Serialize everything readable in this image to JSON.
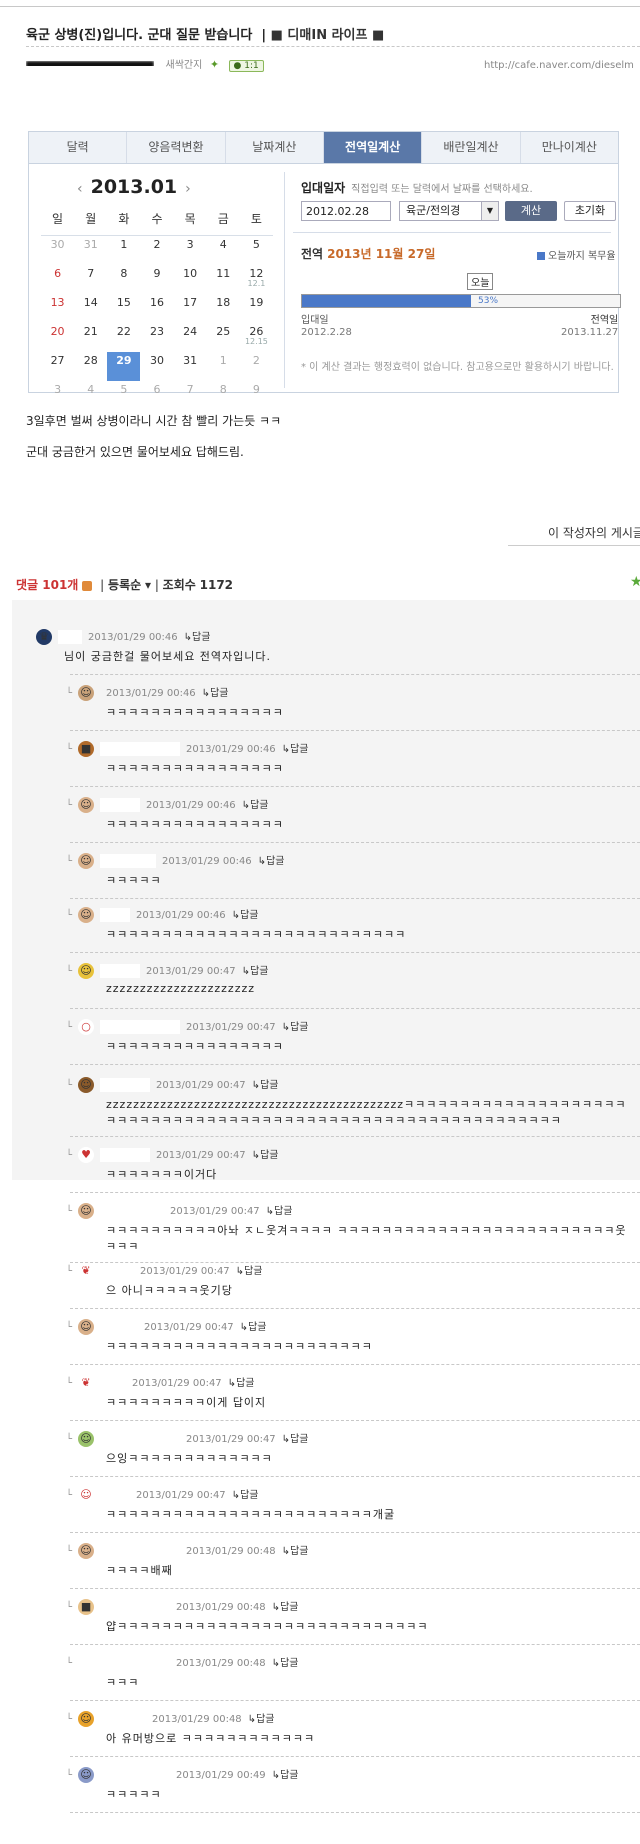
{
  "post": {
    "title": "육군 상병(진)입니다. 군대 질문 받습니다",
    "category": "■ 디매IN 라이프 ■",
    "author_grade": "새싹간지",
    "comment_badge": "1:1",
    "url": "http://cafe.naver.com/dieselm",
    "body_line1": "3일후면 벌써 상병이라니 시간 참 빨리 가는듯 ㅋㅋ",
    "body_line2": "군대 궁금한거 있으면 물어보세요 답해드림.",
    "more_link": "이 작성자의 게시글"
  },
  "calculator": {
    "tabs": [
      "달력",
      "양음력변환",
      "날짜계산",
      "전역일계산",
      "배란일계산",
      "만나이계산"
    ],
    "active_tab": "전역일계산",
    "month_title": "2013.01",
    "prev": "‹",
    "next": "›",
    "weekdays": [
      "일",
      "월",
      "화",
      "수",
      "목",
      "금",
      "토"
    ],
    "weeks": [
      [
        "30",
        "31",
        "1",
        "2",
        "3",
        "4",
        "5"
      ],
      [
        "6",
        "7",
        "8",
        "9",
        "10",
        "11",
        "12"
      ],
      [
        "13",
        "14",
        "15",
        "16",
        "17",
        "18",
        "19"
      ],
      [
        "20",
        "21",
        "22",
        "23",
        "24",
        "25",
        "26"
      ],
      [
        "27",
        "28",
        "29",
        "30",
        "31",
        "1",
        "2"
      ],
      [
        "3",
        "4",
        "5",
        "6",
        "7",
        "8",
        "9"
      ]
    ],
    "subnote_12": "12.1",
    "subnote_26": "12.15",
    "selected_day": "29",
    "enlist_label": "입대일자",
    "enlist_hint": "직접입력 또는 달력에서 날짜를 선택하세요.",
    "enlist_date": "2012.02.28",
    "branch": "육군/전의경",
    "calc_button": "계산",
    "reset_button": "초기화",
    "discharge_label": "전역",
    "discharge_date": "2013년 11월 27일",
    "legend": "오늘까지 복무율",
    "today_label": "오늘",
    "progress_percent": 53,
    "progress_text": "53%",
    "start_label": "입대일",
    "start_date": "2012.2.28",
    "end_label": "전역일",
    "end_date": "2013.11.27",
    "note": "* 이 계산 결과는 행정효력이 없습니다. 참고용으로만 활용하시기 바랍니다."
  },
  "comments_bar": {
    "count_label": "댓글 101개",
    "sort": "등록순",
    "views_label": "조회수",
    "views": "1172"
  },
  "comments": [
    {
      "time": "2013/01/29 00:46",
      "reply": "답글",
      "text": "님이 궁금한걸 물어보세요 전역자입니다.",
      "color": "#223a66",
      "icon": "♛"
    },
    {
      "time": "2013/01/29 00:46",
      "reply": "답글",
      "text": "ㅋㅋㅋㅋㅋㅋㅋㅋㅋㅋㅋㅋㅋㅋㅋㅋ",
      "color": "#c9a27a",
      "icon": "☺"
    },
    {
      "time": "2013/01/29 00:46",
      "reply": "답글",
      "text": "ㅋㅋㅋㅋㅋㅋㅋㅋㅋㅋㅋㅋㅋㅋㅋㅋ",
      "color": "#b06a2a",
      "icon": "■"
    },
    {
      "time": "2013/01/29 00:46",
      "reply": "답글",
      "text": "ㅋㅋㅋㅋㅋㅋㅋㅋㅋㅋㅋㅋㅋㅋㅋㅋ",
      "color": "#d9b08a",
      "icon": "☺"
    },
    {
      "time": "2013/01/29 00:46",
      "reply": "답글",
      "text": "ㅋㅋㅋㅋㅋ",
      "color": "#d9b08a",
      "icon": "☺"
    },
    {
      "time": "2013/01/29 00:46",
      "reply": "답글",
      "text": "ㅋㅋㅋㅋㅋㅋㅋㅋㅋㅋㅋㅋㅋㅋㅋㅋㅋㅋㅋㅋㅋㅋㅋㅋㅋㅋㅋ",
      "color": "#d9b08a",
      "icon": "☺"
    },
    {
      "time": "2013/01/29 00:47",
      "reply": "답글",
      "text": "zzzzzzzzzzzzzzzzzzzzzz",
      "color": "#e8c23a",
      "icon": "☺"
    },
    {
      "time": "2013/01/29 00:47",
      "reply": "답글",
      "text": "ㅋㅋㅋㅋㅋㅋㅋㅋㅋㅋㅋㅋㅋㅋㅋㅋ",
      "color": "#ffffff",
      "icon": "○"
    },
    {
      "time": "2013/01/29 00:47",
      "reply": "답글",
      "text": "zzzzzzzzzzzzzzzzzzzzzzzzzzzzzzzzzzzzzzzzzzzzㅋㅋㅋㅋㅋㅋㅋㅋㅋㅋㅋㅋㅋㅋㅋㅋㅋㅋㅋㅋ",
      "text2": "ㅋㅋㅋㅋㅋㅋㅋㅋㅋㅋㅋㅋㅋㅋㅋㅋㅋㅋㅋㅋㅋㅋㅋㅋㅋㅋㅋㅋㅋㅋㅋㅋㅋㅋㅋㅋㅋㅋㅋㅋㅋ",
      "color": "#8a5a2a",
      "icon": "☺"
    },
    {
      "time": "2013/01/29 00:47",
      "reply": "답글",
      "text": "ㅋㅋㅋㅋㅋㅋㅋ이거다",
      "color": "#ffffff",
      "icon": "♥"
    },
    {
      "time": "2013/01/29 00:47",
      "reply": "답글",
      "text": "ㅋㅋㅋㅋㅋㅋㅋㅋㅋㅋ아놔 ㅈㄴ웃겨ㅋㅋㅋㅋ ㅋㅋㅋㅋㅋㅋㅋㅋㅋㅋㅋㅋㅋㅋㅋㅋㅋㅋㅋㅋㅋㅋㅋㅋㅋ웃",
      "text2": "ㅋㅋㅋ",
      "color": "#d9b08a",
      "icon": "☺"
    },
    {
      "time": "2013/01/29 00:47",
      "reply": "답글",
      "text": "으 아니ㅋㅋㅋㅋㅋ웃기당",
      "color": "#ffffff",
      "icon": "❦"
    },
    {
      "time": "2013/01/29 00:47",
      "reply": "답글",
      "text": "ㅋㅋㅋㅋㅋㅋㅋㅋㅋㅋㅋㅋㅋㅋㅋㅋㅋㅋㅋㅋㅋㅋㅋㅋ",
      "color": "#d9b08a",
      "icon": "☺"
    },
    {
      "time": "2013/01/29 00:47",
      "reply": "답글",
      "text": "ㅋㅋㅋㅋㅋㅋㅋㅋㅋ이게 답이지",
      "color": "#ffffff",
      "icon": "❦"
    },
    {
      "time": "2013/01/29 00:47",
      "reply": "답글",
      "text": "으잉ㅋㅋㅋㅋㅋㅋㅋㅋㅋㅋㅋㅋㅋ",
      "color": "#9ac26a",
      "icon": "☺"
    },
    {
      "time": "2013/01/29 00:47",
      "reply": "답글",
      "text": "ㅋㅋㅋㅋㅋㅋㅋㅋㅋㅋㅋㅋㅋㅋㅋㅋㅋㅋㅋㅋㅋㅋㅋㅋ개굴",
      "color": "#ffffff",
      "icon": "☺"
    },
    {
      "time": "2013/01/29 00:48",
      "reply": "답글",
      "text": "ㅋㅋㅋㅋ배째",
      "color": "#d9b08a",
      "icon": "☺"
    },
    {
      "time": "2013/01/29 00:48",
      "reply": "답글",
      "text": "얍ㅋㅋㅋㅋㅋㅋㅋㅋㅋㅋㅋㅋㅋㅋㅋㅋㅋㅋㅋㅋㅋㅋㅋㅋㅋㅋㅋㅋ",
      "color": "#e8c28a",
      "icon": "■"
    },
    {
      "time": "2013/01/29 00:48",
      "reply": "답글",
      "text": "ㅋㅋㅋ",
      "color": "#ffffff",
      "icon": ""
    },
    {
      "time": "2013/01/29 00:48",
      "reply": "답글",
      "text": "아 유머방으로 ㅋㅋㅋㅋㅋㅋㅋㅋㅋㅋㅋㅋ",
      "color": "#e8a22a",
      "icon": "☺"
    },
    {
      "time": "2013/01/29 00:49",
      "reply": "답글",
      "text": "ㅋㅋㅋㅋㅋ",
      "color": "#8a9ac8",
      "icon": "☺"
    }
  ]
}
